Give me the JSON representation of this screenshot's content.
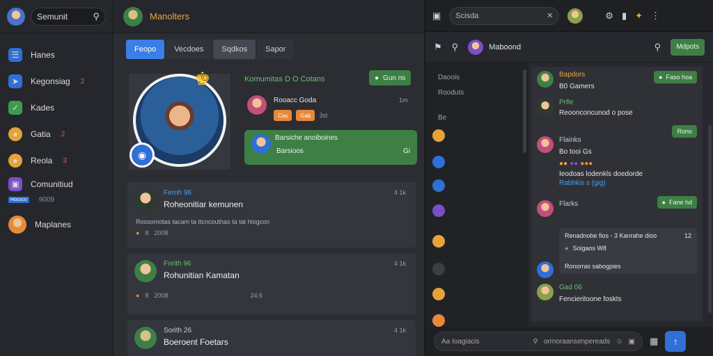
{
  "colors": {
    "accent_blue": "#3a7ee6",
    "accent_green": "#3e7f45",
    "accent_orange": "#f0a43a",
    "badge_red": "#e35b4f"
  },
  "sidebar": {
    "search_value": "Semunit",
    "items": [
      {
        "label": "Hanes",
        "icon": "list-icon",
        "color": "#2f6fd6"
      },
      {
        "label": "Kegonsiag",
        "icon": "send-icon",
        "color": "#2f6fd6",
        "badge": "2"
      },
      {
        "label": "Kades",
        "icon": "chat-icon",
        "color": "#3e9b4d"
      },
      {
        "label": "Gatia",
        "icon": "coin-icon",
        "color": "#e8a23a",
        "badge": "2"
      },
      {
        "label": "Reola",
        "icon": "coin-icon",
        "color": "#e8a23a",
        "badge": "3"
      },
      {
        "label": "Comunitiud",
        "icon": "gamepad-icon",
        "color": "#7b4fc9",
        "sub": "9009",
        "tag": "Hosoco"
      },
      {
        "label": "Maplanes",
        "icon": "avatar-icon",
        "color": "#e8893a"
      }
    ]
  },
  "middle": {
    "title": "Manolters",
    "tabs": [
      "Feopo",
      "Vecdoes",
      "Sqdkos",
      "Sapor"
    ],
    "info_head": "Komumitas D O Cotans",
    "top_chip": "Gun ns",
    "sub_name": "Rooacc Goda",
    "sub_meta": "1m",
    "orange_chips": [
      "Cas",
      "Gab"
    ],
    "sub_count": "3st",
    "green_card_top": "Barsiche anoiboines",
    "green_card_bottom": "Barsioos",
    "green_card_count": "Gi",
    "posts": [
      {
        "name": "Fernh 96",
        "title": "Roheonitiar kemunen",
        "meta": "4  1k",
        "body": "Rossomotas tacam ta ttcncouthas ta tat hlogcon",
        "count_a": "8",
        "count_b": "2008"
      },
      {
        "name": "Fnrith 96",
        "title": "Rohunitian Kamatan",
        "meta": "4  1k",
        "count_a": "8",
        "count_b": "2008",
        "count_c": "24.6"
      },
      {
        "name": "Sorith 26",
        "title": "Boeroent Foetars",
        "meta": "4  1k"
      }
    ]
  },
  "right": {
    "search_value": "Scisda",
    "channel_title": "Maboond",
    "action_button": "Mdpots",
    "channels": [
      "Daoois",
      "Rooduts",
      "Be"
    ],
    "messages": [
      {
        "name": "Bapdors",
        "line": "B0  Gamers"
      },
      {
        "name": "Prfle",
        "line": "Reoonconcunod o pose"
      },
      {
        "name": "Flainks",
        "line": "Bo tooi  Gs",
        "body": "Ieodoas lodenkls doedorde",
        "link": "Rabhkis s (gig)"
      },
      {
        "name": "Flarks"
      },
      {
        "name": "Gad 06",
        "line": "Fencieritoone foskts"
      }
    ],
    "chips": [
      "Faso  hoa",
      "Rono",
      "Fane  hd"
    ],
    "bubble_top": "Renadnobe fios - 3 Kanrahe dioo",
    "bubble_count": "12",
    "bubble_sub": "Soigaos  W8",
    "bubble_body": "Ronorras sabogpies",
    "input_placeholder": "Aa Ioagiacis",
    "input_hint": "orrnoraansenpereads"
  }
}
